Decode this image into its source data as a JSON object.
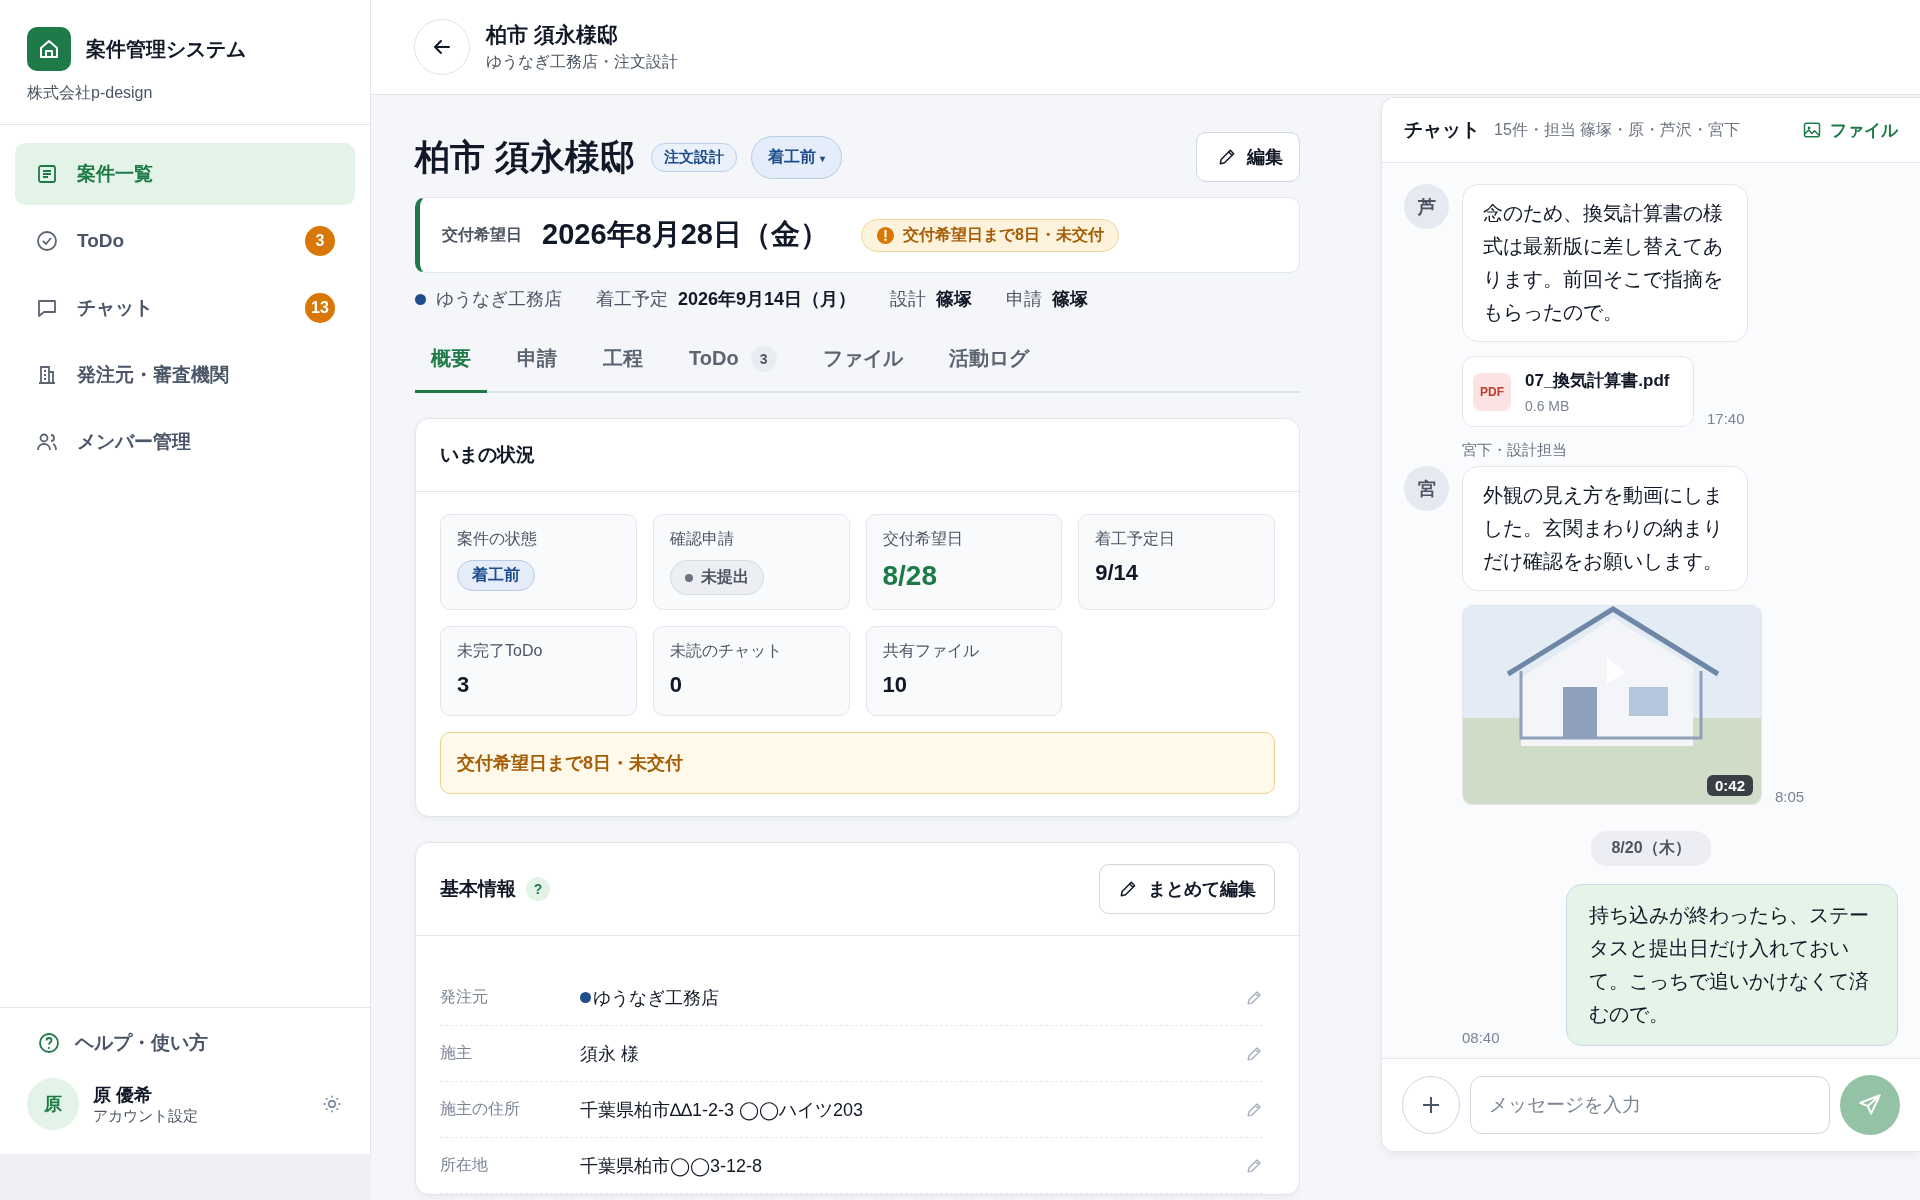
{
  "sidebar": {
    "app_title": "案件管理システム",
    "company": "株式会社p-design",
    "nav": [
      {
        "label": "案件一覧",
        "selected": true
      },
      {
        "label": "ToDo",
        "badge": "3",
        "selected": false
      },
      {
        "label": "チャット",
        "badge": "13",
        "selected": false
      },
      {
        "label": "発注元・審査機関",
        "selected": false
      },
      {
        "label": "メンバー管理",
        "selected": false
      }
    ],
    "help": "ヘルプ・使い方",
    "user": {
      "avatar": "原",
      "name": "原 優希",
      "sub": "アカウント設定"
    }
  },
  "header": {
    "title": "柏市 須永様邸",
    "subtitle": "ゆうなぎ工務店・注文設計"
  },
  "project": {
    "title": "柏市 須永様邸",
    "tag": "注文設計",
    "status": "着工前",
    "status_caret": "▾",
    "edit_button": "編集"
  },
  "deadline": {
    "label": "交付希望日",
    "date": "2026年8月28日（金）",
    "alert": "交付希望日まで8日・未交付"
  },
  "meta": [
    {
      "kind": "client",
      "value": "ゆうなぎ工務店",
      "color": "#1e4d8c"
    },
    {
      "kind": "field",
      "label": "着工予定",
      "value": "2026年9月14日（月）"
    },
    {
      "kind": "field",
      "label": "設計",
      "value": "篠塚"
    },
    {
      "kind": "field",
      "label": "申請",
      "value": "篠塚"
    }
  ],
  "tabs": [
    {
      "label": "概要",
      "selected": true
    },
    {
      "label": "申請",
      "selected": false
    },
    {
      "label": "工程",
      "selected": false
    },
    {
      "label": "ToDo",
      "count": "3",
      "selected": false
    },
    {
      "label": "ファイル",
      "selected": false
    },
    {
      "label": "活動ログ",
      "selected": false
    }
  ],
  "status": {
    "title": "いまの状況",
    "tiles": [
      {
        "kind": "state",
        "label": "案件の状態",
        "value": "着工前"
      },
      {
        "kind": "pill",
        "label": "確認申請",
        "value": "未提出"
      },
      {
        "kind": "value",
        "label": "交付希望日",
        "value": "8/28",
        "highlight": true
      },
      {
        "kind": "value",
        "label": "着工予定日",
        "value": "9/14",
        "highlight": false
      },
      {
        "kind": "value",
        "label": "未完了ToDo",
        "value": "3",
        "highlight": false
      },
      {
        "kind": "value",
        "label": "未読のチャット",
        "value": "0",
        "highlight": false
      },
      {
        "kind": "value",
        "label": "共有ファイル",
        "value": "10",
        "highlight": false
      }
    ],
    "notice": "交付希望日まで8日・未交付"
  },
  "basic_info": {
    "title": "基本情報",
    "help_mark": "?",
    "edit_button": "まとめて編集",
    "rows": [
      {
        "label": "発注元",
        "value": "ゆうなぎ工務店",
        "color": "#1e4d8c"
      },
      {
        "label": "施主",
        "value": "須永 様"
      },
      {
        "label": "施主の住所",
        "value": "千葉県柏市∆∆1-2-3 ◯◯ハイツ203"
      },
      {
        "label": "所在地",
        "value": "千葉県柏市◯◯3-12-8"
      }
    ]
  },
  "chat": {
    "title": "チャット",
    "summary": "15件・担当 篠塚・原・芦沢・宮下",
    "files_link": "ファイル",
    "messages": [
      {
        "kind": "text",
        "outgoing": false,
        "avatar": "芦",
        "text": "念のため、換気計算書の様式は最新版に差し替えてあります。前回そこで指摘をもらったので。"
      },
      {
        "kind": "file",
        "outgoing": false,
        "file_type": "PDF",
        "name": "07_換気計算書.pdf",
        "size": "0.6 MB",
        "time": "17:40"
      },
      {
        "kind": "text",
        "outgoing": false,
        "sender": "宮下・設計担当",
        "avatar": "宮",
        "text": "外観の見え方を動画にしました。玄関まわりの納まりだけ確認をお願いします。"
      },
      {
        "kind": "video",
        "outgoing": false,
        "duration": "0:42",
        "time": "8:05"
      },
      {
        "kind": "date",
        "text": "8/20（木）"
      },
      {
        "kind": "text",
        "outgoing": true,
        "text": "持ち込みが終わったら、ステータスと提出日だけ入れておいて。こっちで追いかけなくて済むので。",
        "time": "08:40"
      }
    ],
    "placeholder": "メッセージを入力"
  }
}
